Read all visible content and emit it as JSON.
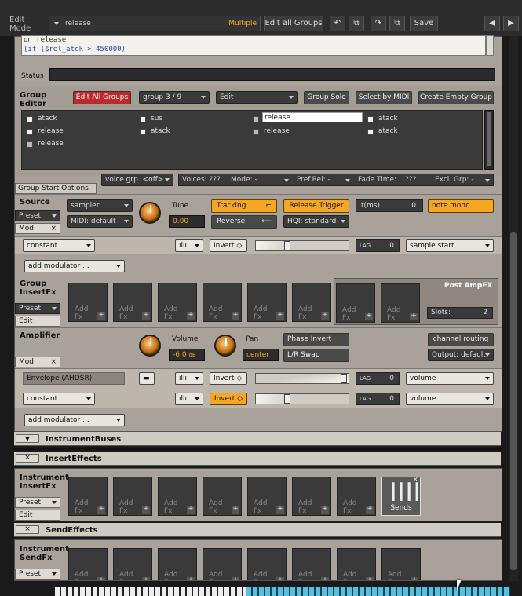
{
  "topbar": {
    "edit_mode": "Edit Mode",
    "group_select": "release",
    "multiple": "Multiple",
    "edit_all_groups": "Edit all Groups",
    "save": "Save"
  },
  "script": {
    "line1": "on release",
    "line2": "{if ($rel_atck > 450000)"
  },
  "status_label": "Status",
  "group_editor": {
    "title": "Group Editor",
    "edit_all": "Edit All Groups",
    "group_select": "group 3 / 9",
    "edit_select": "Edit",
    "group_solo": "Group Solo",
    "select_by_midi": "Select by MIDI",
    "create_empty": "Create Empty Group",
    "groups": [
      "atack",
      "sus",
      "release",
      "atack",
      "release",
      "atack",
      "release",
      "atack",
      "release"
    ]
  },
  "group_start": {
    "voice_grp": "voice grp. <off>",
    "voices": "Voices: ???",
    "mode": "Mode: -",
    "pref_rel": "Pref.Rel: -",
    "fade_time": "Fade Time:",
    "fade_val": "???",
    "excl_grp": "Excl. Grp: -",
    "tab_label": "Group Start Options"
  },
  "source": {
    "title": "Source",
    "preset": "Preset",
    "mod": "Mod",
    "sampler": "sampler",
    "midi": "MIDI: default",
    "tune": "Tune",
    "tune_val": "0.00",
    "tracking": "Tracking",
    "reverse": "Reverse",
    "release_trigger": "Release Trigger",
    "hq": "HQI: standard",
    "tms": "t(ms):",
    "tms_val": "0",
    "note_mono": "note mono"
  },
  "mod_row1": {
    "source": "constant",
    "invert": "Invert",
    "lag": "LAG",
    "lag_val": "0",
    "target": "sample start"
  },
  "add_modulator": "add modulator ...",
  "insert_fx": {
    "title": "Group InsertFx",
    "preset": "Preset",
    "edit": "Edit",
    "slot_t1": "Add",
    "slot_t2": "Fx",
    "post_amp": "Post AmpFX",
    "slots_label": "Slots:",
    "slots_val": "2"
  },
  "amplifier": {
    "title": "Amplifier",
    "mod": "Mod",
    "volume": "Volume",
    "volume_val": "-6.0",
    "db": "dB",
    "pan": "Pan",
    "pan_val": "center",
    "phase_invert": "Phase Invert",
    "lr_swap": "L/R Swap",
    "channel_routing": "channel routing",
    "output": "Output: default"
  },
  "mod_row2": {
    "source": "Envelope (AHDSR)",
    "invert": "Invert",
    "lag": "LAG",
    "lag_val": "0",
    "target": "volume"
  },
  "mod_row3": {
    "source": "constant",
    "invert": "Invert",
    "lag": "LAG",
    "lag_val": "0",
    "target": "volume"
  },
  "bottom": {
    "instrument_buses": "InstrumentBuses",
    "insert_effects": "InsertEffects",
    "inst_insert_title": "Instrument InsertFx",
    "preset": "Preset",
    "edit": "Edit",
    "sends": "Sends",
    "send_effects": "SendEffects",
    "inst_send_title": "Instrument SendFx"
  }
}
